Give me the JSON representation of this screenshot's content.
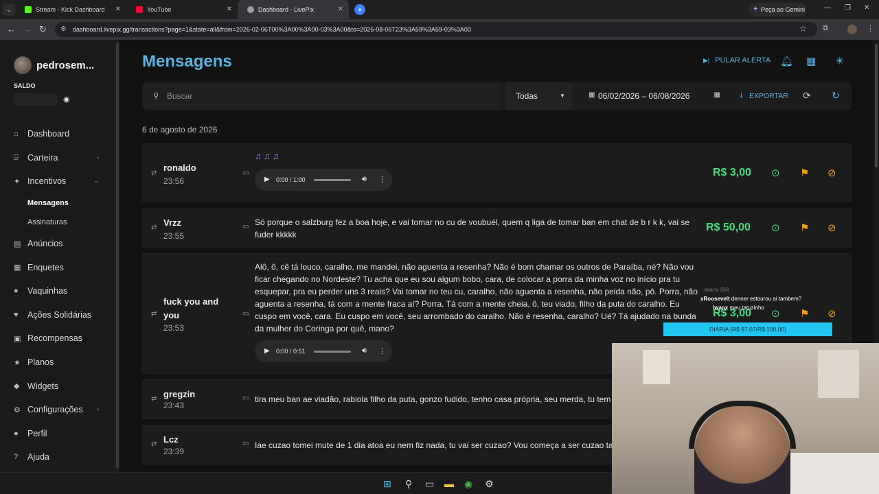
{
  "browser": {
    "tabs": [
      {
        "title": "Stream - Kick Dashboard",
        "active": false
      },
      {
        "title": "YouTube",
        "active": false
      },
      {
        "title": "Dashboard - LivePix",
        "active": true
      }
    ],
    "new_tab": "+",
    "gemini_label": "Peça ao Gemini",
    "url": "dashboard.livepix.gg/transactions?page=1&state=all&from=2026-02-06T00%3A00%3A00-03%3A00&to=2026-08-06T23%3A59%3A59-03%3A00"
  },
  "sidebar": {
    "username": "pedrosem...",
    "balance_label": "SALDO",
    "items": [
      {
        "label": "Dashboard",
        "icon": "home-icon"
      },
      {
        "label": "Carteira",
        "icon": "bank-icon",
        "chevron": "›"
      },
      {
        "label": "Incentivos",
        "icon": "sparkle-icon",
        "chevron": "⌄"
      },
      {
        "label": "Mensagens",
        "sub": true,
        "active": true
      },
      {
        "label": "Assinaturas",
        "sub": true
      },
      {
        "label": "Anúncios",
        "icon": "megaphone-icon"
      },
      {
        "label": "Enquetes",
        "icon": "poll-icon"
      },
      {
        "label": "Vaquinhas",
        "icon": "piggy-icon"
      },
      {
        "label": "Ações Solidárias",
        "icon": "heart-icon"
      },
      {
        "label": "Recompensas",
        "icon": "gift-icon"
      },
      {
        "label": "Planos",
        "icon": "star-icon"
      },
      {
        "label": "Widgets",
        "icon": "widget-icon"
      },
      {
        "label": "Configurações",
        "icon": "gear-icon",
        "chevron": "›"
      },
      {
        "label": "Perfil",
        "icon": "user-icon"
      },
      {
        "label": "Ajuda",
        "icon": "help-icon"
      }
    ]
  },
  "header": {
    "title": "Mensagens",
    "skip_alert": "PULAR ALERTA"
  },
  "filters": {
    "search_placeholder": "Buscar",
    "state": "Todas",
    "date_range": "06/02/2026 – 06/08/2026",
    "export": "EXPORTAR"
  },
  "date_group": "6 de agosto de 2026",
  "messages": [
    {
      "name": "ronaldo",
      "time": "23:56",
      "notes": "♫♫♫",
      "audio": "0:00 / 1:00",
      "amount": "R$ 3,00"
    },
    {
      "name": "Vrzz",
      "time": "23:55",
      "text": "Só porque o salzburg fez a boa hoje, e vai tomar no cu de voubuél, quem q liga de tomar ban em chat de b r k k, vai se fuder kkkkk",
      "amount": "R$ 50,00"
    },
    {
      "name": "fuck you and you",
      "time": "23:53",
      "text": "Alô, ô, cê tá louco, caralho, me mandei, não aguenta a resenha? Não é bom chamar os outros de Paraíba, né? Não vou ficar chegando no Nordeste? Tu acha que eu sou algum bobo, cara, de colocar a porra da minha voz no início pra tu esquepar, pra eu perder uns 3 reais? Vai tomar no teu cu, caralho, não aguenta a resenha, não peida não, pô. Porra, não aguenta a resenha, tá com a mente fraca aí? Porra. Tá com a mente cheia, ô, teu viado, filho da puta do caralho. Eu cuspo em você, cara. Eu cuspo em você, seu arrombado do caralho. Não é resenha, caralho? Ué? Tá ajudado na bunda da mulher do Coringa por quê, mano?",
      "audio": "0:00 / 0:51",
      "amount": "R$ 3,00"
    },
    {
      "name": "gregzin",
      "time": "23:43",
      "text": "tira meu ban ae viadão, rabiola filho da puta, gonzo fudido, tenho casa própria, seu merda, tu tem"
    },
    {
      "name": "Lcz",
      "time": "23:39",
      "text": "Iae cuzao tomei mute de 1 dia atoa eu nem fiz nada, tu vai ser cuzao? Vou começa a ser cuzao tam"
    }
  ],
  "overlay": {
    "chat": [
      {
        "user": "lwanx",
        "text": "SIR"
      },
      {
        "user": "xRoosevelt",
        "text": "denner estourou ai tambem?"
      },
      {
        "user": "lwanx",
        "text": "meu tatuzinho"
      }
    ],
    "goal": "DIÁRIA (R$ 97,07/R$ 100,00)",
    "goal_progress": 0.97
  },
  "colors": {
    "accent": "#5fb2e0",
    "amount": "#4ade80",
    "warn": "#f59e0b"
  }
}
